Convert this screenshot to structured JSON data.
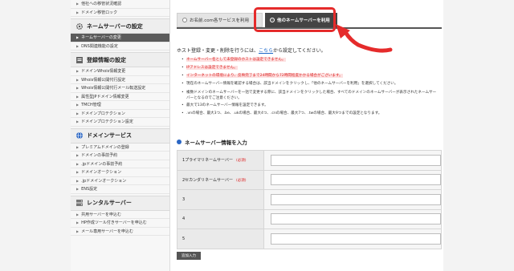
{
  "sidebar": {
    "top_items": [
      "他社への移管状況確認",
      "ドメイン移管ロック"
    ],
    "sections": [
      {
        "title": "ネームサーバーの設定",
        "icon": "gear-icon",
        "items": [
          "ネームサーバーの変更",
          "DNS関連機能の設定"
        ],
        "active": 0
      },
      {
        "title": "登録情報の設定",
        "icon": "profile-icon",
        "items": [
          "ドメインWhois情報変更",
          "Whois情報公開代行設定",
          "Whois情報公開代行メール転送設定",
          "属性型JPドメイン情報変更",
          "TMCH管理",
          "ドメインプロテクション",
          "ドメインプロテクション設定"
        ]
      },
      {
        "title": "ドメインサービス",
        "icon": "globe-icon",
        "items": [
          "プレミアムドメインの登録",
          "ドメインの事前予約",
          ".jpドメインの事前予約",
          "ドメインオークション",
          ".jpドメインオークション",
          "ENS設定"
        ]
      },
      {
        "title": "レンタルサーバー",
        "icon": "server-icon",
        "items": [
          "共用サーバーを申込む",
          "HP作成ツール付きサーバーを申込む",
          "メール専用サーバーを申込む"
        ]
      }
    ]
  },
  "tabs": [
    {
      "label": "お名前.com各サービスを利用",
      "selected": false
    },
    {
      "label": "他のネームサーバーを利用",
      "selected": true
    }
  ],
  "intro": {
    "before": "ホスト登録・変更・削除を行うには、",
    "link": "こちら",
    "after": "から設定してください。"
  },
  "notes": [
    {
      "text": "ネームサーバー名として未登録のホストは設定できません。",
      "red": true
    },
    {
      "text": "IPアドレスは設定できません。",
      "red": true
    },
    {
      "text": "インターネットの環境により、反映完了まで24時間から72時間程度かかる場合がございます。",
      "red": true
    },
    {
      "text": "現在のネームサーバー情報を確認する場合は、該当ドメインをクリックし、「他のネームサーバーを利用」を選択してください。",
      "red": false
    },
    {
      "text": "複数ドメインのネームサーバーを一括で変更する際に、該当ドメインをクリックした場合、すべてのドメインのネームサーバーが表示されたネームサーバーとなるのでご注意ください。",
      "red": false,
      "wrap": true
    },
    {
      "text": "最大で13のネームサーバー情報を設定できます。",
      "red": false
    },
    {
      "text": ".vnの場合、最大3つ、.be、.ukの場合、最大4つ、.cnの場合、最大7つ、.twの場合、最大9つまでの設定となります。",
      "red": false
    }
  ],
  "form": {
    "title": "ネームサーバー情報を入力",
    "required_label": "(必須)",
    "rows": [
      {
        "label": "1プライマリネームサーバー",
        "required": true,
        "value": ""
      },
      {
        "label": "2セカンダリネームサーバー",
        "required": true,
        "value": ""
      },
      {
        "label": "3",
        "required": false,
        "value": ""
      },
      {
        "label": "4",
        "required": false,
        "value": ""
      },
      {
        "label": "5",
        "required": false,
        "value": ""
      }
    ],
    "add_button": "追加入力"
  },
  "colors": {
    "highlight": "#e52b2b",
    "link": "#1a66c8",
    "alert": "#d22222",
    "accent_blue": "#2a66c4"
  }
}
